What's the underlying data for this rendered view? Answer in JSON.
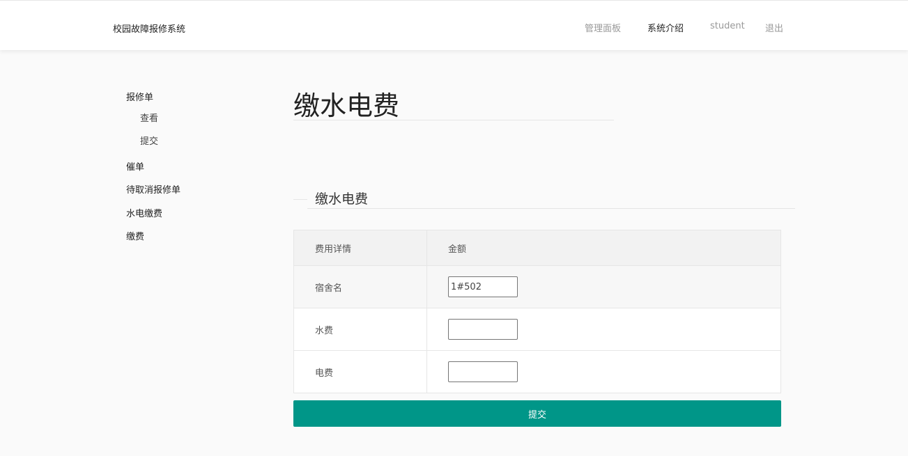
{
  "header": {
    "brand": "校园故障报修系统",
    "nav": [
      {
        "label": "管理面板",
        "active": false
      },
      {
        "label": "系统介绍",
        "active": true
      },
      {
        "label": "student",
        "active": false
      },
      {
        "label": "退出",
        "active": false
      }
    ]
  },
  "sidebar": {
    "groups": [
      {
        "label": "报修单",
        "children": [
          "查看",
          "提交"
        ]
      },
      {
        "label": "催单",
        "children": []
      },
      {
        "label": "待取消报修单",
        "children": []
      },
      {
        "label": "水电缴费",
        "children": []
      },
      {
        "label": "缴费",
        "children": []
      }
    ]
  },
  "main": {
    "title": "缴水电费",
    "section_title": "缴水电费",
    "table": {
      "headers": [
        "费用详情",
        "金额"
      ],
      "rows": [
        {
          "label": "宿舍名",
          "value": "1#502"
        },
        {
          "label": "水费",
          "value": ""
        },
        {
          "label": "电费",
          "value": ""
        }
      ]
    },
    "submit_label": "提交"
  },
  "colors": {
    "accent": "#009688",
    "topbar_bg": "#ffffff",
    "page_bg": "#fafafa"
  }
}
